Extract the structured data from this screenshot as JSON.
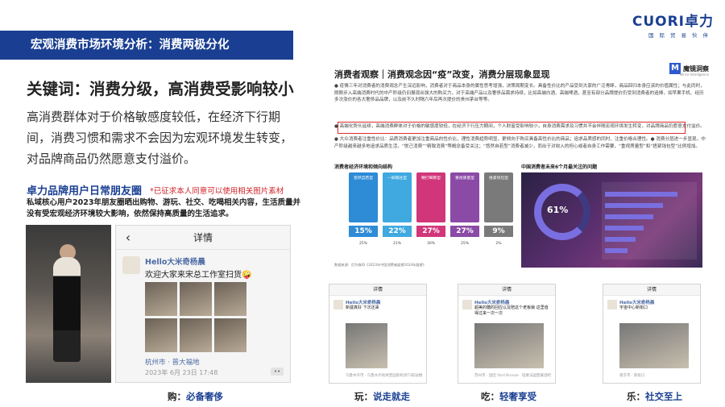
{
  "header": {
    "title": "宏观消费市场环境分析：消费两极分化"
  },
  "logo": {
    "brand": "CUORI卓力",
    "tagline": "国际贸易伙伴"
  },
  "left": {
    "keyword_title": "关键词：消费分级，高消费受影响较小",
    "keyword_body": "高消费群体对于价格敏感度较低，在经济下行期间，消费习惯和需求不会因为宏观环境发生转变，对品牌商品仍然愿意支付溢价。",
    "section_title": "卓力品牌用户日常朋友圈",
    "section_note": "*已征求本人同意可以使用相关图片素材",
    "section_desc": "私域核心用户2023年朋友圈晒出购物、游玩、社交、吃喝相关内容，生活质量并没有受宏观经济环境较大影响，依然保持高质量的生活追求。",
    "wechat": {
      "title": "详情",
      "user": "Hello大米奇杨晨",
      "text": "欢迎大家来宋总工作室扫货🤪",
      "location": "杭州市 · 普大福地",
      "date": "2023年 6月 23日 17:48"
    },
    "caption_prefix": "购：",
    "caption_hl": "必备奢侈"
  },
  "article": {
    "title": "消费者观察｜消费观念因“疫”改变，消费分层现象显现",
    "logo_text": "魔镜洞察",
    "logo_sub": "Mirror Intelligence",
    "p1": "● 疫情三年对消费者的消费观念产生深远影响，消费者对于商品本身的属性思考增强，决策周期变长。具备性价比的产品受到大家的广泛青睐，商品回归本身应该的价值属性；与此同时，刚刚步入高端消费时代的中产阶级仍旧展现出强大的购买力，对于高端产品以及奢侈品需求持续，比如高端白酒、高端啤酒，甚至有部分品牌提价仍受到消费者的追捧，如苹果手机、经历多次涨价的各大奢侈品品牌，以及前不久时隔六年后再次提价的贵州茅台等等。",
    "p2": "● 高端化势头延续，高端消费群体对于价格的敏感度较低，在经济下行压力期间，个人财富受影响较小，自身消费需求及习惯并不会伴随宏观环境发生转变，对品牌商品仍愿意支付溢价。",
    "p3": "● 大众消费者注重性价比：品质消费者更加注重商品的性价比，理性消费趋势明显，更倾向于购买具备高性价比的商品；追求品质感的同时，注重价格合理性。● 消费分层进一步显现，中产阶级越来越多地追求品质生活，“悦己消费”“精致消费”等概念备受关注；“悠然自若型”消费者减少，而出于对收入的担心或者自身工作需要，“重视质量型”和“捂紧钱包型”比例增加。",
    "sub_left": "消费者经济环境和倾向结构",
    "sub_right": "中国消费者未来6个月最关注的问题",
    "source": "数据来源：尼尔森IQ《2023年中国消费者展望2024年展望》",
    "ring_value": "61%"
  },
  "tiles": [
    {
      "label": "悠然自若型",
      "pct": "15%",
      "year": "25%",
      "color": "#2e8bd6"
    },
    {
      "label": "一如既往型",
      "pct": "22%",
      "year": "21%",
      "color": "#3fa9e0"
    },
    {
      "label": "精打细算型",
      "pct": "27%",
      "year": "30%",
      "color": "#d2367a"
    },
    {
      "label": "重视质量型",
      "pct": "27%",
      "year": "25%",
      "color": "#8b4aa6"
    },
    {
      "label": "捂紧钱包型",
      "pct": "9%",
      "year": "2%",
      "color": "#7a7a7a"
    }
  ],
  "minis": [
    {
      "title": "详情",
      "user": "Hello大米奇杨晨",
      "text": "新疆真好 下次还来",
      "foot": "乌鲁木齐市 · 乌鲁木齐地窝堡国际机场T3航站楼",
      "caption_prefix": "玩：",
      "caption_hl": "说走就走"
    },
    {
      "title": "详情",
      "user": "Hello大米奇杨晨",
      "text": "超美的糖的回应以及陪这个老板娘 这里值得过来一次一次",
      "foot": "苏州市 · 团团 Yard Bronze · 轻奢法国西餐酒吧",
      "caption_prefix": "吃：",
      "caption_hl": "轻奢享受"
    },
    {
      "title": "详情",
      "user": "Hello大米奇杨晨",
      "text": "宇宙中心新街口",
      "foot": "南京市 · 新街口",
      "caption_prefix": "乐：",
      "caption_hl": "社交至上"
    }
  ]
}
